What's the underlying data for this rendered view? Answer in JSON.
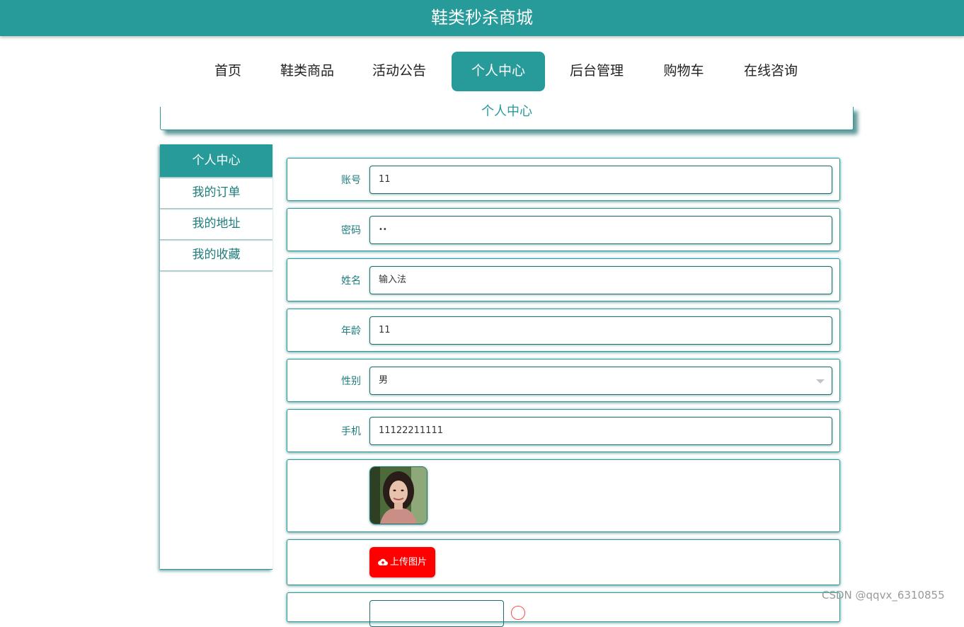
{
  "header": {
    "title": "鞋类秒杀商城"
  },
  "nav": {
    "items": [
      {
        "label": "首页"
      },
      {
        "label": "鞋类商品"
      },
      {
        "label": "活动公告"
      },
      {
        "label": "个人中心"
      },
      {
        "label": "后台管理"
      },
      {
        "label": "购物车"
      },
      {
        "label": "在线咨询"
      }
    ],
    "active_index": 3
  },
  "page": {
    "title": "个人中心"
  },
  "sidebar": {
    "items": [
      {
        "label": "个人中心"
      },
      {
        "label": "我的订单"
      },
      {
        "label": "我的地址"
      },
      {
        "label": "我的收藏"
      }
    ],
    "active_index": 0
  },
  "form": {
    "account": {
      "label": "账号",
      "value": "11"
    },
    "password": {
      "label": "密码",
      "value": "••"
    },
    "name": {
      "label": "姓名",
      "value": "输入法"
    },
    "age": {
      "label": "年龄",
      "value": "11"
    },
    "gender": {
      "label": "性别",
      "value": "男"
    },
    "phone": {
      "label": "手机",
      "value": "11122211111"
    },
    "upload_label": "上传图片"
  },
  "watermark": "CSDN @qqvx_6310855",
  "colors": {
    "primary": "#279a9a",
    "danger": "#ff0000"
  }
}
